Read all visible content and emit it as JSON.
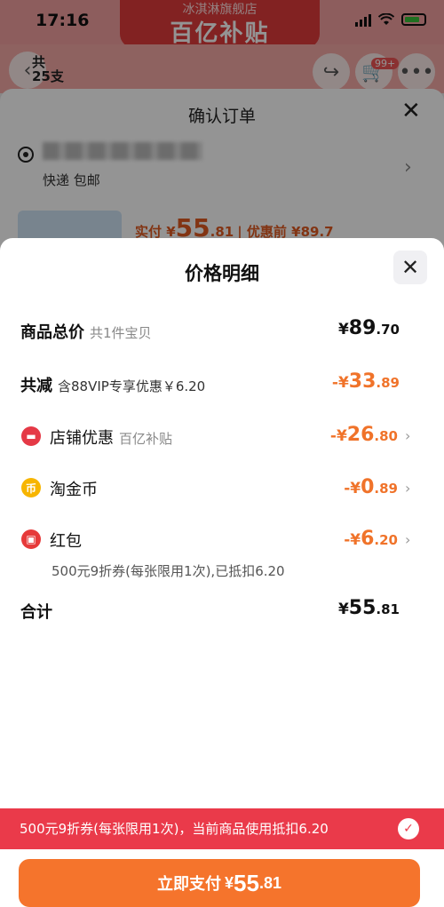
{
  "status_bar": {
    "time": "17:16"
  },
  "banner": {
    "sub": "冰淇淋旗舰店",
    "title": "百亿补贴"
  },
  "header": {
    "count_line1": "共",
    "count_line2": "25支",
    "cart_badge": "99+"
  },
  "confirm_order": {
    "title": "确认订单",
    "shipping": "快递 包邮",
    "paid_label": "实付 ¥",
    "paid_int": "55",
    "paid_dec": ".81",
    "pre_discount_label": "| 优惠前 ¥89.7"
  },
  "price_detail": {
    "title": "价格明细",
    "rows": [
      {
        "label": "商品总价",
        "sub": "共1件宝贝",
        "currency": "¥",
        "int": "89",
        "dec": ".70"
      },
      {
        "label": "共减",
        "sub": "含88VIP专享优惠￥6.20",
        "currency": "-¥",
        "int": "33",
        "dec": ".89"
      },
      {
        "label": "店铺优惠",
        "sub": "百亿补贴",
        "currency": "-¥",
        "int": "26",
        "dec": ".80"
      },
      {
        "label": "淘金币",
        "sub": "",
        "currency": "-¥",
        "int": "0",
        "dec": ".89"
      },
      {
        "label": "红包",
        "sub": "",
        "currency": "-¥",
        "int": "6",
        "dec": ".20"
      },
      {
        "label": "合计",
        "sub": "",
        "currency": "¥",
        "int": "55",
        "dec": ".81"
      }
    ],
    "redpacket_note": "500元9折券(每张限用1次),已抵扣6.20"
  },
  "coupon_bar": {
    "text": "500元9折券(每张限用1次)，当前商品使用抵扣6.20"
  },
  "pay_button": {
    "label": "立即支付",
    "currency": "¥",
    "int": "55",
    "dec": ".81"
  },
  "colors": {
    "accent_orange": "#f5742c",
    "coupon_red": "#ea3a4a",
    "amount_orange": "#f0732a"
  },
  "icons": [
    "back-icon",
    "share-icon",
    "cart-icon",
    "more-icon",
    "close-icon",
    "location-icon",
    "chevron-right-icon",
    "store-icon",
    "coin-icon",
    "red-packet-icon",
    "check-icon"
  ]
}
